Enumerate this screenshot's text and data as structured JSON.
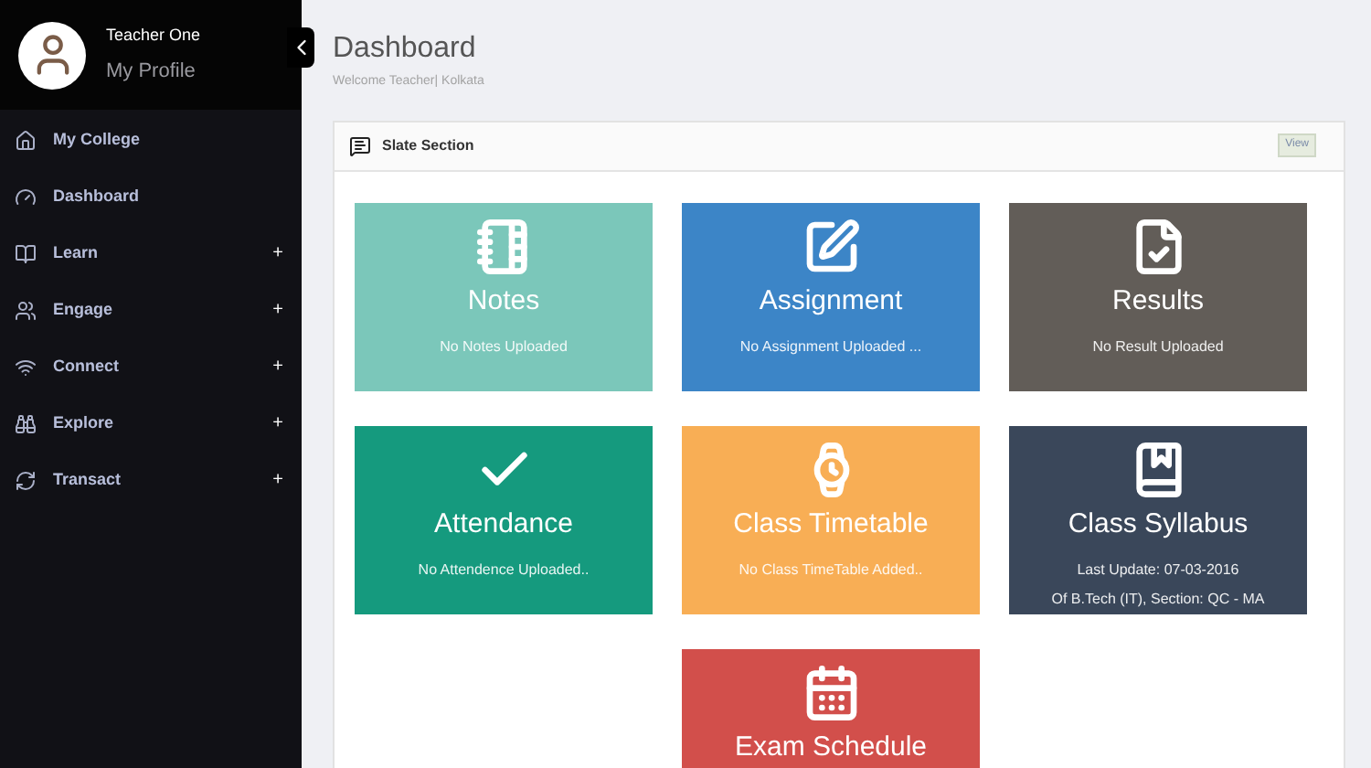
{
  "profile": {
    "name": "Teacher One",
    "link": "My Profile"
  },
  "sidebar": {
    "items": [
      {
        "label": "My College"
      },
      {
        "label": "Dashboard"
      },
      {
        "label": "Learn",
        "toggle": "+"
      },
      {
        "label": "Engage",
        "toggle": "+"
      },
      {
        "label": "Connect",
        "toggle": "+"
      },
      {
        "label": "Explore",
        "toggle": "+"
      },
      {
        "label": "Transact",
        "toggle": "+"
      }
    ]
  },
  "page": {
    "title": "Dashboard",
    "subtitle": "Welcome Teacher| Kolkata"
  },
  "panel": {
    "title": "Slate Section",
    "action": "View",
    "tiles": [
      {
        "title": "Notes",
        "lines": [
          "No Notes Uploaded"
        ],
        "color": "#7bc7ba"
      },
      {
        "title": "Assignment",
        "lines": [
          "No Assignment Uploaded ..."
        ],
        "color": "#3c85c7"
      },
      {
        "title": "Results",
        "lines": [
          "No Result Uploaded"
        ],
        "color": "#625d58"
      },
      {
        "title": "Attendance",
        "lines": [
          "No Attendence Uploaded.."
        ],
        "color": "#159a7e"
      },
      {
        "title": "Class Timetable",
        "lines": [
          "No Class TimeTable Added.."
        ],
        "color": "#f8ae55"
      },
      {
        "title": "Class Syllabus",
        "lines": [
          "Last Update: 07-03-2016",
          "Of B.Tech (IT), Section: QC - MA"
        ],
        "color": "#3a475a"
      },
      {
        "title": "Exam Schedule",
        "color": "#d24f4b"
      }
    ]
  }
}
